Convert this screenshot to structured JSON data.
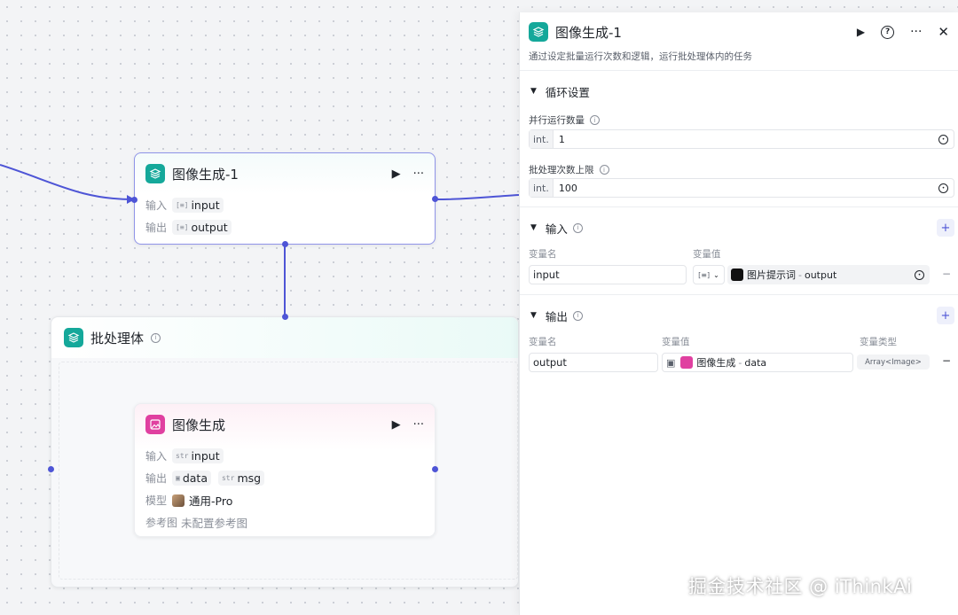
{
  "canvas": {
    "node_top": {
      "title": "图像生成-1",
      "input_label": "输入",
      "input_var": "input",
      "output_label": "输出",
      "output_var": "output"
    },
    "batch_container": {
      "title": "批处理体"
    },
    "node_image": {
      "title": "图像生成",
      "input_label": "输入",
      "input_type": "str",
      "input_var": "input",
      "output_label": "输出",
      "output_var_1": "data",
      "output_type_2": "str",
      "output_var_2": "msg",
      "model_label": "模型",
      "model_value": "通用-Pro",
      "ref_label": "参考图",
      "ref_value": "未配置参考图"
    }
  },
  "panel": {
    "title": "图像生成-1",
    "description": "通过设定批量运行次数和逻辑，运行批处理体内的任务",
    "loop_section": {
      "title": "循环设置",
      "parallel_label": "并行运行数量",
      "parallel_prefix": "int.",
      "parallel_value": "1",
      "max_label": "批处理次数上限",
      "max_prefix": "int.",
      "max_value": "100"
    },
    "input_section": {
      "title": "输入",
      "col_name": "变量名",
      "col_value": "变量值",
      "var_name": "input",
      "ref_source": "图片提示词",
      "ref_sep": "-",
      "ref_field": "output"
    },
    "output_section": {
      "title": "输出",
      "col_name": "变量名",
      "col_value": "变量值",
      "col_type": "变量类型",
      "var_name": "output",
      "ref_source": "图像生成",
      "ref_sep": "-",
      "ref_field": "data",
      "var_type": "Array<Image>"
    }
  },
  "watermark": "掘金技术社区 @ iThinkAi",
  "colors": {
    "accent": "#4e55d6",
    "teal": "#14a89a",
    "pink": "#e040a0"
  }
}
